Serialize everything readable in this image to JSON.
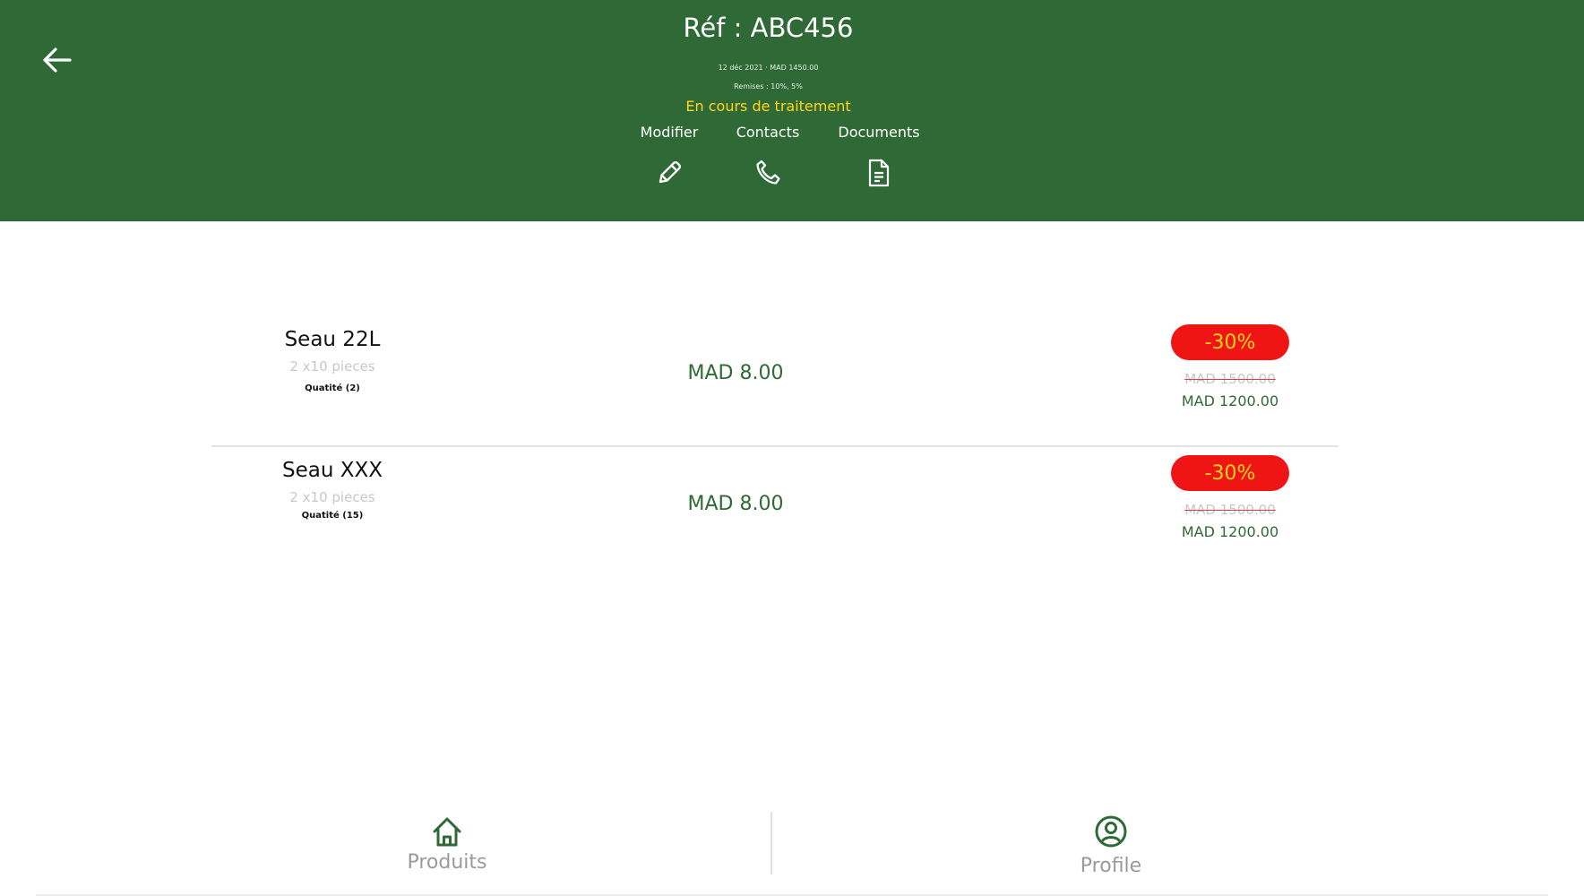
{
  "header": {
    "title": "Réf : ABC456",
    "meta_line_1": "12 déc 2021 · MAD 1450.00",
    "meta_line_2": "Remises : 10%, 5%",
    "status": "En cours de traitement",
    "back_icon": "arrow-left-icon",
    "actions": [
      {
        "label": "Modifier",
        "icon": "pencil-icon"
      },
      {
        "label": "Contacts",
        "icon": "phone-icon"
      },
      {
        "label": "Documents",
        "icon": "document-icon"
      }
    ]
  },
  "products": [
    {
      "name": "Seau 22L",
      "packaging": "2 x10 pieces",
      "quantity": "Quatité (2)",
      "unit_price": "MAD 8.00",
      "discount": "-30%",
      "old_price": "MAD 1500.00",
      "new_price": "MAD 1200.00"
    },
    {
      "name": "Seau XXX",
      "packaging": "2 x10 pieces",
      "quantity": "Quatité (15)",
      "unit_price": "MAD 8.00",
      "discount": "-30%",
      "old_price": "MAD 1500.00",
      "new_price": "MAD 1200.00"
    }
  ],
  "bottom_nav": [
    {
      "label": "Produits",
      "icon": "home-icon"
    },
    {
      "label": "Profile",
      "icon": "user-circle-icon"
    }
  ],
  "colors": {
    "header_bg": "#2e6936",
    "status": "#ffd51c",
    "price_green": "#2f6a35",
    "discount_badge": "#f01515"
  }
}
